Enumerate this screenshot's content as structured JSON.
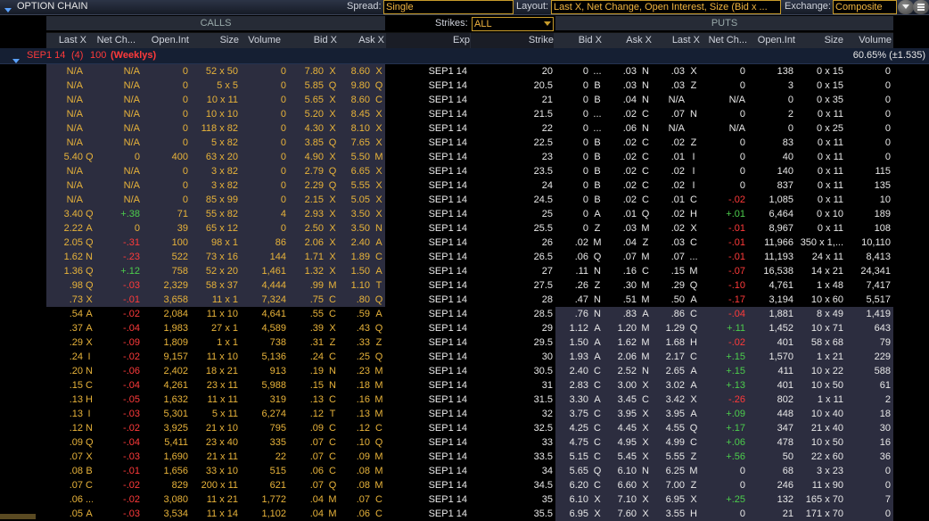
{
  "window": {
    "title": "OPTION CHAIN"
  },
  "toolbar": {
    "spread_label": "Spread:",
    "spread_value": "Single",
    "layout_label": "Layout:",
    "layout_value": "Last X, Net Change, Open Interest, Size (Bid x ...",
    "exchange_label": "Exchange:",
    "exchange_value": "Composite"
  },
  "sections": {
    "calls": "CALLS",
    "puts": "PUTS",
    "strikes_label": "Strikes:",
    "strikes_value": "ALL"
  },
  "call_columns": [
    "Last X",
    "Net Ch...",
    "Open.Int",
    "Size",
    "Volume",
    "Bid X",
    "Ask X"
  ],
  "middle_columns": [
    "Exp",
    "Strike"
  ],
  "put_columns": [
    "Bid X",
    "Ask X",
    "Last X",
    "Net Ch...",
    "Open.Int",
    "Size",
    "Volume"
  ],
  "group": {
    "label": "SEP1 14",
    "count": "(4)",
    "multiplier": "100",
    "tag": "(Weeklys)",
    "iv": "60.65% (±1.535)"
  },
  "colors": {
    "in_money_calls": "#2c2d3f",
    "in_money_puts": "#2c2d3f",
    "out_money": "#000000",
    "call_text": "#e8b33a",
    "put_text": "#e8e8e8",
    "positive": "#4ccd4c",
    "negative": "#ff3a3a"
  },
  "rows": [
    [
      "N/A",
      "N/A",
      "0",
      "52 x 50",
      "0",
      "7.80",
      "X",
      "8.60",
      "X",
      "SEP1 14",
      "20",
      "0",
      "...",
      ".03",
      "N",
      ".03",
      "X",
      "0",
      "138",
      "0 x 15",
      "0"
    ],
    [
      "N/A",
      "N/A",
      "0",
      "5 x 5",
      "0",
      "5.85",
      "Q",
      "9.80",
      "Q",
      "SEP1 14",
      "20.5",
      "0",
      "B",
      ".03",
      "N",
      ".03",
      "Z",
      "0",
      "3",
      "0 x 15",
      "0"
    ],
    [
      "N/A",
      "N/A",
      "0",
      "10 x 11",
      "0",
      "5.65",
      "X",
      "8.60",
      "C",
      "SEP1 14",
      "21",
      "0",
      "B",
      ".04",
      "N",
      "N/A",
      "",
      "N/A",
      "0",
      "0 x 35",
      "0"
    ],
    [
      "N/A",
      "N/A",
      "0",
      "10 x 10",
      "0",
      "5.20",
      "X",
      "8.45",
      "X",
      "SEP1 14",
      "21.5",
      "0",
      "...",
      ".02",
      "C",
      ".07",
      "N",
      "0",
      "2",
      "0 x 11",
      "0"
    ],
    [
      "N/A",
      "N/A",
      "0",
      "118 x 82",
      "0",
      "4.30",
      "X",
      "8.10",
      "X",
      "SEP1 14",
      "22",
      "0",
      "...",
      ".06",
      "N",
      "N/A",
      "",
      "N/A",
      "0",
      "0 x 25",
      "0"
    ],
    [
      "N/A",
      "N/A",
      "0",
      "5 x 82",
      "0",
      "3.85",
      "Q",
      "7.65",
      "X",
      "SEP1 14",
      "22.5",
      "0",
      "B",
      ".02",
      "C",
      ".02",
      "Z",
      "0",
      "83",
      "0 x 11",
      "0"
    ],
    [
      "5.40",
      "Q",
      "0",
      "400",
      "63 x 20",
      "0",
      "4.90",
      "X",
      "5.50",
      "M",
      "SEP1 14",
      "23",
      "0",
      "B",
      ".02",
      "C",
      ".01",
      "I",
      "0",
      "40",
      "0 x 11",
      "0"
    ],
    [
      "N/A",
      "N/A",
      "0",
      "3 x 82",
      "0",
      "2.79",
      "Q",
      "6.65",
      "X",
      "SEP1 14",
      "23.5",
      "0",
      "B",
      ".02",
      "C",
      ".02",
      "I",
      "0",
      "140",
      "0 x 11",
      "115"
    ],
    [
      "N/A",
      "N/A",
      "0",
      "3 x 82",
      "0",
      "2.29",
      "Q",
      "5.55",
      "X",
      "SEP1 14",
      "24",
      "0",
      "B",
      ".02",
      "C",
      ".02",
      "I",
      "0",
      "837",
      "0 x 11",
      "135"
    ],
    [
      "N/A",
      "N/A",
      "0",
      "85 x 99",
      "0",
      "2.15",
      "X",
      "5.05",
      "X",
      "SEP1 14",
      "24.5",
      "0",
      "B",
      ".02",
      "C",
      ".01",
      "C",
      "-.02",
      "1,085",
      "0 x 11",
      "10"
    ],
    [
      "3.40",
      "Q",
      "+.38",
      "71",
      "55 x 82",
      "4",
      "2.93",
      "X",
      "3.50",
      "X",
      "SEP1 14",
      "25",
      "0",
      "A",
      ".01",
      "Q",
      ".02",
      "H",
      "+.01",
      "6,464",
      "0 x 10",
      "189"
    ],
    [
      "2.22",
      "A",
      "0",
      "39",
      "65 x 12",
      "0",
      "2.50",
      "X",
      "3.50",
      "N",
      "SEP1 14",
      "25.5",
      "0",
      "Z",
      ".03",
      "M",
      ".02",
      "X",
      "-.01",
      "8,967",
      "0 x 11",
      "108"
    ],
    [
      "2.05",
      "Q",
      "-.31",
      "100",
      "98 x 1",
      "86",
      "2.06",
      "X",
      "2.40",
      "A",
      "SEP1 14",
      "26",
      ".02",
      "M",
      ".04",
      "Z",
      ".03",
      "C",
      "-.01",
      "11,966",
      "350 x 1,...",
      "10,110"
    ],
    [
      "1.62",
      "N",
      "-.23",
      "522",
      "73 x 16",
      "144",
      "1.71",
      "X",
      "1.89",
      "C",
      "SEP1 14",
      "26.5",
      ".06",
      "Q",
      ".07",
      "M",
      ".07",
      "...",
      "-.01",
      "11,193",
      "24 x 11",
      "8,413"
    ],
    [
      "1.36",
      "Q",
      "+.12",
      "758",
      "52 x 20",
      "1,461",
      "1.32",
      "X",
      "1.50",
      "A",
      "SEP1 14",
      "27",
      ".11",
      "N",
      ".16",
      "C",
      ".15",
      "M",
      "-.07",
      "16,538",
      "14 x 21",
      "24,341"
    ],
    [
      ".98",
      "Q",
      "-.03",
      "2,329",
      "58 x 37",
      "4,444",
      ".99",
      "M",
      "1.10",
      "T",
      "SEP1 14",
      "27.5",
      ".26",
      "Z",
      ".30",
      "M",
      ".29",
      "Q",
      "-.10",
      "4,761",
      "1 x 48",
      "7,417"
    ],
    [
      ".73",
      "X",
      "-.01",
      "3,658",
      "11 x 1",
      "7,324",
      ".75",
      "C",
      ".80",
      "Q",
      "SEP1 14",
      "28",
      ".47",
      "N",
      ".51",
      "M",
      ".50",
      "A",
      "-.17",
      "3,194",
      "10 x 60",
      "5,517"
    ],
    [
      ".54",
      "A",
      "-.02",
      "2,084",
      "11 x 10",
      "4,641",
      ".55",
      "C",
      ".59",
      "A",
      "SEP1 14",
      "28.5",
      ".76",
      "N",
      ".83",
      "A",
      ".86",
      "C",
      "-.04",
      "1,881",
      "8 x 49",
      "1,419"
    ],
    [
      ".37",
      "A",
      "-.04",
      "1,983",
      "27 x 1",
      "4,589",
      ".39",
      "X",
      ".43",
      "Q",
      "SEP1 14",
      "29",
      "1.12",
      "A",
      "1.20",
      "M",
      "1.29",
      "Q",
      "+.11",
      "1,452",
      "10 x 71",
      "643"
    ],
    [
      ".29",
      "X",
      "-.09",
      "1,809",
      "1 x 1",
      "738",
      ".31",
      "Z",
      ".33",
      "Z",
      "SEP1 14",
      "29.5",
      "1.50",
      "A",
      "1.62",
      "M",
      "1.68",
      "H",
      "-.02",
      "401",
      "58 x 68",
      "79"
    ],
    [
      ".24",
      "I",
      "-.02",
      "9,157",
      "11 x 10",
      "5,136",
      ".24",
      "C",
      ".25",
      "Q",
      "SEP1 14",
      "30",
      "1.93",
      "A",
      "2.06",
      "M",
      "2.17",
      "C",
      "+.15",
      "1,570",
      "1 x 21",
      "229"
    ],
    [
      ".20",
      "N",
      "-.06",
      "2,402",
      "18 x 21",
      "913",
      ".19",
      "N",
      ".23",
      "M",
      "SEP1 14",
      "30.5",
      "2.40",
      "C",
      "2.52",
      "N",
      "2.65",
      "A",
      "+.15",
      "411",
      "10 x 22",
      "588"
    ],
    [
      ".15",
      "C",
      "-.04",
      "4,261",
      "23 x 11",
      "5,988",
      ".15",
      "N",
      ".18",
      "M",
      "SEP1 14",
      "31",
      "2.83",
      "C",
      "3.00",
      "X",
      "3.02",
      "A",
      "+.13",
      "401",
      "10 x 50",
      "61"
    ],
    [
      ".13",
      "H",
      "-.05",
      "1,632",
      "11 x 11",
      "319",
      ".13",
      "C",
      ".16",
      "M",
      "SEP1 14",
      "31.5",
      "3.30",
      "A",
      "3.45",
      "C",
      "3.42",
      "X",
      "-.26",
      "802",
      "1 x 11",
      "2"
    ],
    [
      ".13",
      "I",
      "-.03",
      "5,301",
      "5 x 11",
      "6,274",
      ".12",
      "T",
      ".13",
      "M",
      "SEP1 14",
      "32",
      "3.75",
      "C",
      "3.95",
      "X",
      "3.95",
      "A",
      "+.09",
      "448",
      "10 x 40",
      "18"
    ],
    [
      ".12",
      "N",
      "-.02",
      "3,925",
      "21 x 10",
      "795",
      ".09",
      "C",
      ".12",
      "C",
      "SEP1 14",
      "32.5",
      "4.25",
      "C",
      "4.45",
      "X",
      "4.55",
      "Q",
      "+.17",
      "347",
      "21 x 40",
      "30"
    ],
    [
      ".09",
      "Q",
      "-.04",
      "5,411",
      "23 x 40",
      "335",
      ".07",
      "C",
      ".10",
      "Q",
      "SEP1 14",
      "33",
      "4.75",
      "C",
      "4.95",
      "X",
      "4.99",
      "C",
      "+.06",
      "478",
      "10 x 50",
      "16"
    ],
    [
      ".07",
      "X",
      "-.03",
      "1,690",
      "21 x 11",
      "22",
      ".07",
      "C",
      ".09",
      "M",
      "SEP1 14",
      "33.5",
      "5.15",
      "C",
      "5.45",
      "X",
      "5.55",
      "Z",
      "+.56",
      "50",
      "22 x 60",
      "36"
    ],
    [
      ".08",
      "B",
      "-.01",
      "1,656",
      "33 x 10",
      "515",
      ".06",
      "C",
      ".08",
      "M",
      "SEP1 14",
      "34",
      "5.65",
      "Q",
      "6.10",
      "N",
      "6.25",
      "M",
      "0",
      "68",
      "3 x 23",
      "0"
    ],
    [
      ".07",
      "C",
      "-.02",
      "829",
      "200 x 11",
      "621",
      ".07",
      "Q",
      ".08",
      "M",
      "SEP1 14",
      "34.5",
      "6.20",
      "C",
      "6.60",
      "X",
      "7.00",
      "Z",
      "0",
      "246",
      "11 x 90",
      "0"
    ],
    [
      ".06",
      "...",
      "-.02",
      "3,080",
      "11 x 21",
      "1,772",
      ".04",
      "M",
      ".07",
      "C",
      "SEP1 14",
      "35",
      "6.10",
      "X",
      "7.10",
      "X",
      "6.95",
      "X",
      "+.25",
      "132",
      "165 x 70",
      "7"
    ],
    [
      ".05",
      "A",
      "-.03",
      "3,534",
      "11 x 14",
      "1,102",
      ".04",
      "M",
      ".06",
      "C",
      "SEP1 14",
      "35.5",
      "6.95",
      "X",
      "7.60",
      "X",
      "3.55",
      "H",
      "0",
      "21",
      "171 x 70",
      "0"
    ]
  ]
}
